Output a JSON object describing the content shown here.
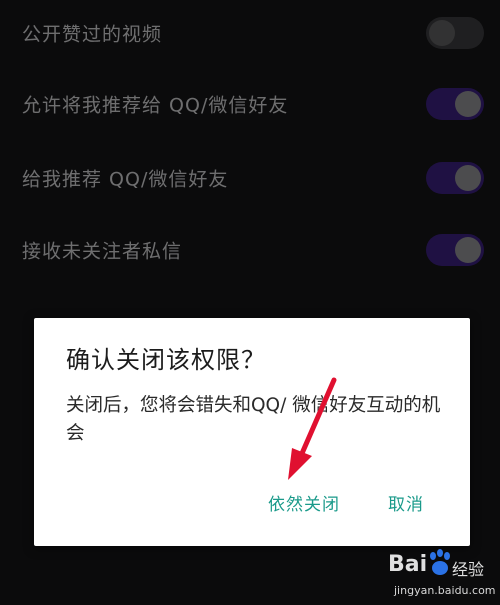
{
  "settings": [
    {
      "label": "公开赞过的视频",
      "state": "off"
    },
    {
      "label": "允许将我推荐给 QQ/微信好友",
      "state": "on"
    },
    {
      "label": "给我推荐 QQ/微信好友",
      "state": "on"
    },
    {
      "label": "接收未关注者私信",
      "state": "on"
    }
  ],
  "dialog": {
    "title": "确认关闭该权限？",
    "message": "关闭后，您将会错失和QQ/ 微信好友互动的机会",
    "confirm_label": "依然关闭",
    "cancel_label": "取消"
  },
  "watermark": {
    "logo_left": "Bai",
    "logo_right": "经验",
    "url": "jingyan.baidu.com"
  },
  "colors": {
    "accent": "#1a9a8a",
    "toggle_on": "#3a1f7a",
    "arrow": "#e01030"
  }
}
